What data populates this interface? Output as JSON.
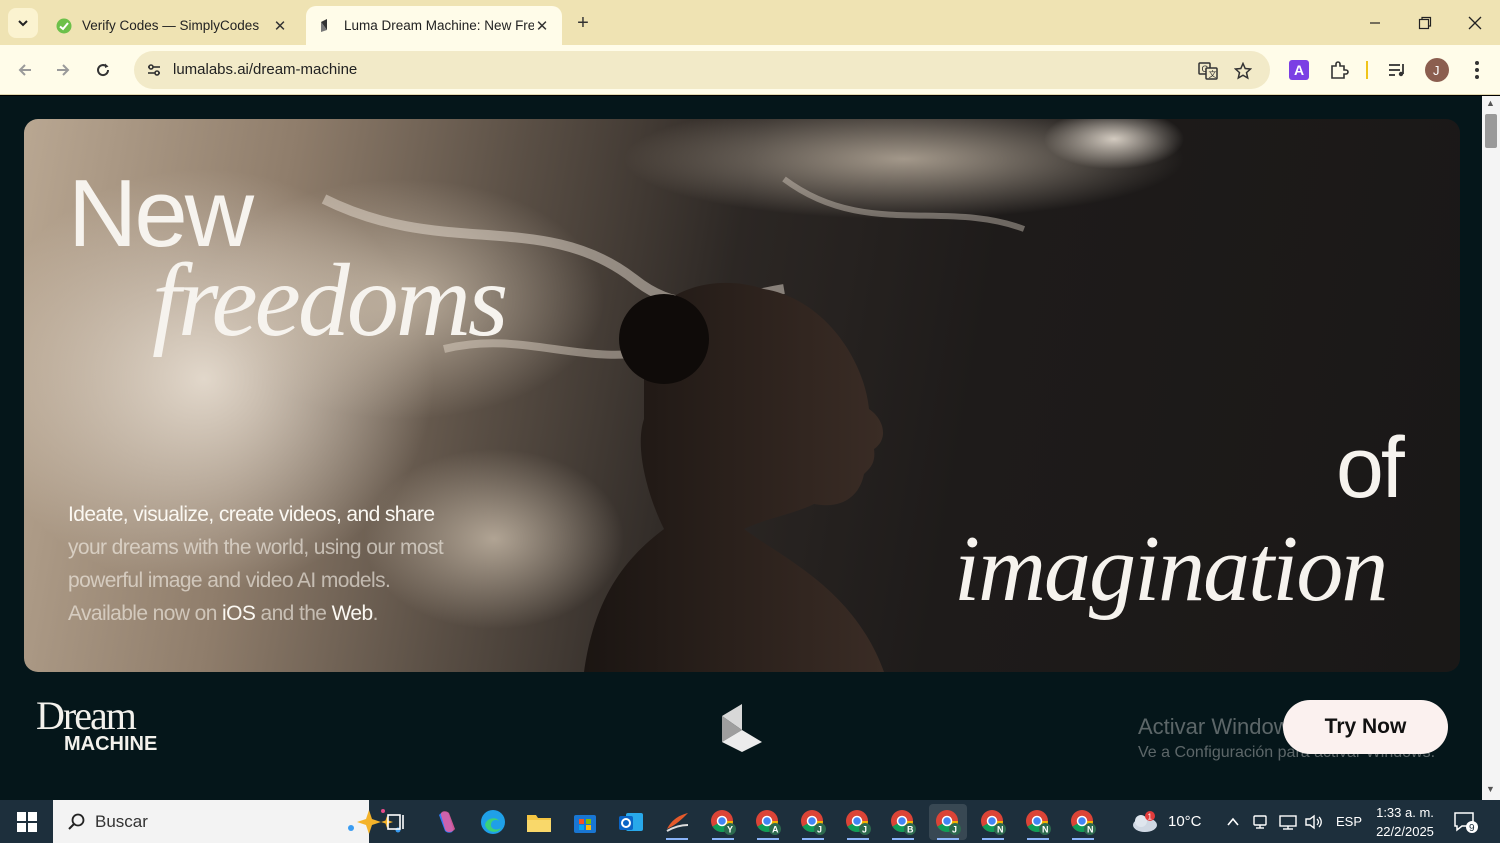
{
  "browser": {
    "tabs": [
      {
        "title": "Verify Codes — SimplyCodes",
        "active": false
      },
      {
        "title": "Luma Dream Machine: New Fre",
        "active": true
      }
    ],
    "url": "lumalabs.ai/dream-machine",
    "profile_initial": "J",
    "extension_badge": "A"
  },
  "hero": {
    "word_new": "New",
    "word_freedoms": "freedoms",
    "word_of": "of",
    "word_imagination": "imagination",
    "desc_line1": "Ideate, visualize, create videos, and share",
    "desc_line2": "your dreams with the world, using our most",
    "desc_line3": "powerful image and video AI models.",
    "desc_available": "Available now on ",
    "desc_ios": "iOS",
    "desc_and": " and the ",
    "desc_web": "Web",
    "desc_period": "."
  },
  "footer": {
    "brand_line1": "Dream",
    "brand_line2": "MACHINE",
    "try_now": "Try Now"
  },
  "watermark": {
    "title": "Activar Windows",
    "subtitle": "Ve a Configuración para activar Windows."
  },
  "taskbar": {
    "search_placeholder": "Buscar",
    "weather_temp": "10°C",
    "weather_badge": "1",
    "language": "ESP",
    "time": "1:33 a. m.",
    "date": "22/2/2025",
    "notifications": "9",
    "chrome_profiles": [
      "Y",
      "A",
      "J",
      "J",
      "B",
      "J",
      "N",
      "N",
      "N"
    ]
  },
  "colors": {
    "tabstrip": "#efe3b3",
    "toolbar": "#fffce9",
    "page_bg": "#05161a",
    "try_now_bg": "#fbf1ef",
    "taskbar": "#1d2f3c"
  }
}
